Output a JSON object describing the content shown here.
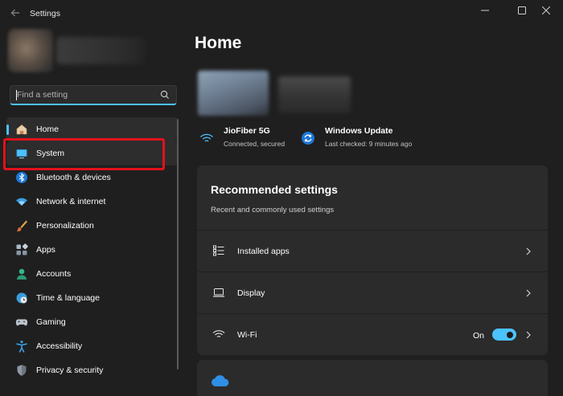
{
  "window": {
    "title": "Settings",
    "back_icon": "back-arrow-icon",
    "controls": [
      "minimize-icon",
      "maximize-icon",
      "close-icon"
    ]
  },
  "search": {
    "placeholder": "Find a setting",
    "icon": "search-icon"
  },
  "sidebar": {
    "items": [
      {
        "label": "Home",
        "icon": "home-icon",
        "active": true
      },
      {
        "label": "System",
        "icon": "monitor-icon",
        "highlighted": true
      },
      {
        "label": "Bluetooth & devices",
        "icon": "bluetooth-icon"
      },
      {
        "label": "Network & internet",
        "icon": "wifi-icon"
      },
      {
        "label": "Personalization",
        "icon": "brush-icon"
      },
      {
        "label": "Apps",
        "icon": "apps-icon"
      },
      {
        "label": "Accounts",
        "icon": "person-icon"
      },
      {
        "label": "Time & language",
        "icon": "globe-clock-icon"
      },
      {
        "label": "Gaming",
        "icon": "gamepad-icon"
      },
      {
        "label": "Accessibility",
        "icon": "accessibility-icon"
      },
      {
        "label": "Privacy & security",
        "icon": "shield-icon"
      }
    ]
  },
  "main": {
    "title": "Home",
    "status": [
      {
        "title": "JioFiber 5G",
        "subtitle": "Connected, secured",
        "icon": "wifi-icon"
      },
      {
        "title": "Windows Update",
        "subtitle": "Last checked: 9 minutes ago",
        "icon": "update-icon"
      }
    ],
    "recommended": {
      "title": "Recommended settings",
      "subtitle": "Recent and commonly used settings",
      "rows": [
        {
          "label": "Installed apps",
          "icon": "list-icon"
        },
        {
          "label": "Display",
          "icon": "laptop-icon"
        },
        {
          "label": "Wi-Fi",
          "icon": "wifi-icon",
          "toggle_label": "On",
          "toggle_on": true
        }
      ]
    },
    "next_card_icon": "onedrive-cloud-icon"
  },
  "colors": {
    "accent": "#4cc2ff",
    "highlight_box": "#e0121b",
    "background": "#1f1f1f",
    "card": "#2b2b2b"
  }
}
